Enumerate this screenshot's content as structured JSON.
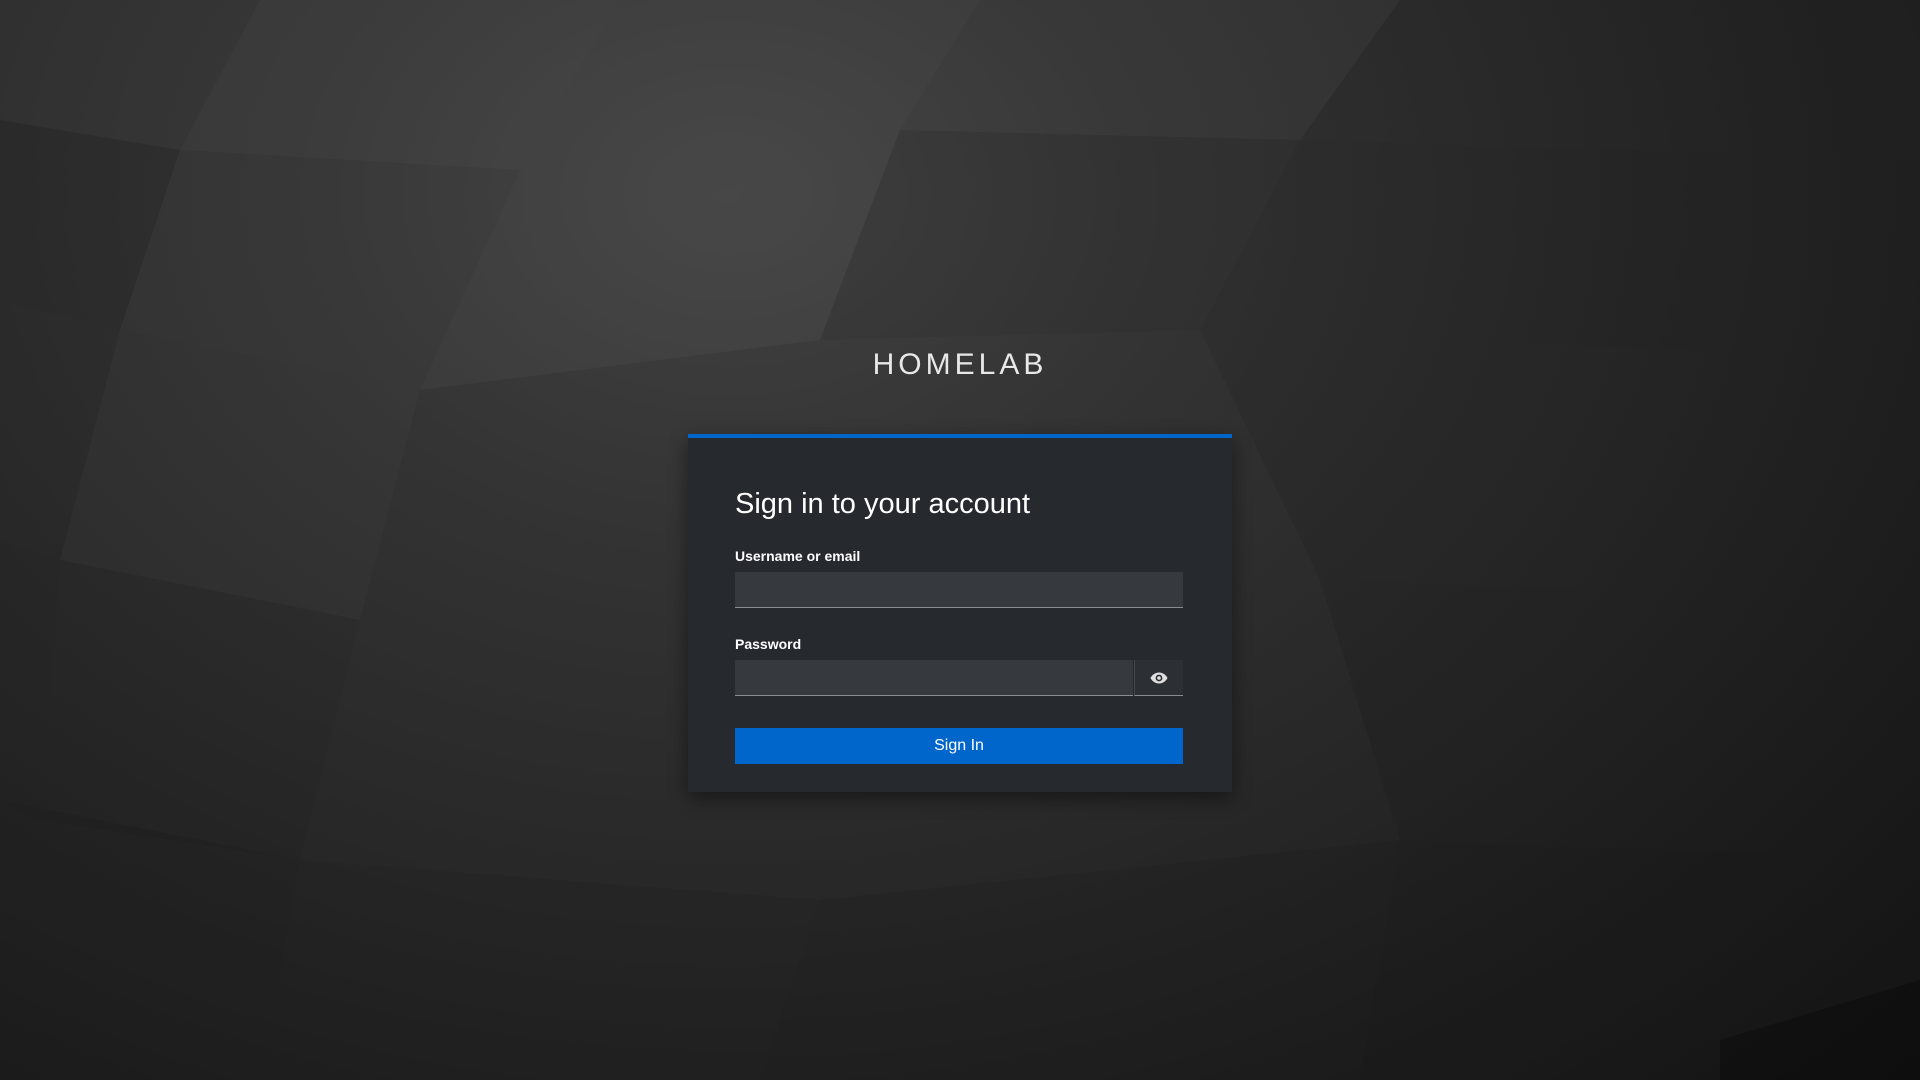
{
  "brand": {
    "title": "HOMELAB"
  },
  "login": {
    "heading": "Sign in to your account",
    "username_label": "Username or email",
    "username_value": "",
    "password_label": "Password",
    "password_value": "",
    "toggle_icon": "eye-icon",
    "submit_label": "Sign In"
  },
  "colors": {
    "accent": "#0066cc",
    "card_background": "#26292d",
    "input_background": "#36393d"
  }
}
